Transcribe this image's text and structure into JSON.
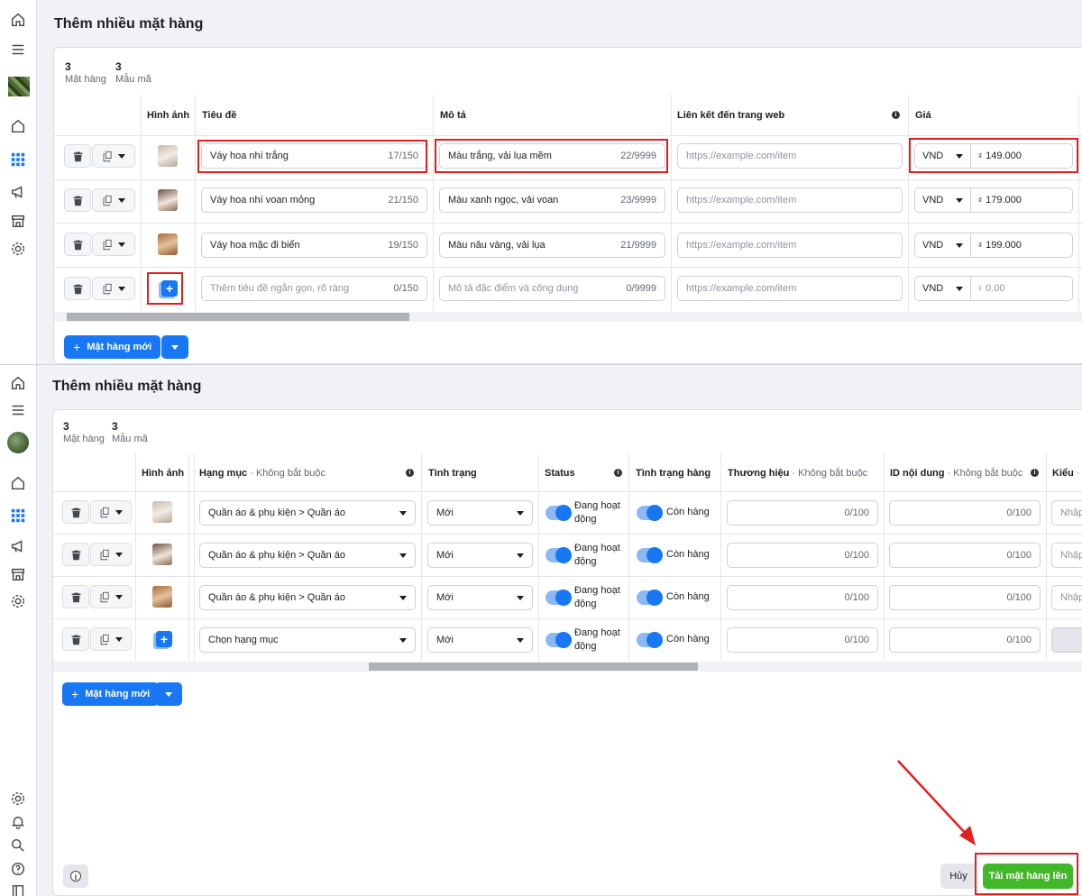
{
  "panel1": {
    "title": "Thêm nhiều mặt hàng",
    "stats": {
      "items_count": "3",
      "items_label": "Mặt hàng",
      "variants_count": "3",
      "variants_label": "Mẫu mã"
    },
    "headers": {
      "image": "Hình ảnh",
      "title": "Tiêu đề",
      "description": "Mô tả",
      "link": "Liên kết đến trang web",
      "price": "Giá"
    },
    "rows": [
      {
        "title": "Váy hoa nhí trắng",
        "title_count": "17/150",
        "desc": "Màu trắng, vải lụa mềm",
        "desc_count": "22/9999",
        "link_placeholder": "https://example.com/item",
        "currency": "VND",
        "price_symbol": "₫",
        "price": "149.000"
      },
      {
        "title": "Váy hoa nhí voan mỏng",
        "title_count": "21/150",
        "desc": "Màu xanh ngọc, vải voan",
        "desc_count": "23/9999",
        "link_placeholder": "https://example.com/item",
        "currency": "VND",
        "price_symbol": "₫",
        "price": "179.000"
      },
      {
        "title": "Váy hoa mặc đi biển",
        "title_count": "19/150",
        "desc": "Màu nâu vàng, vải lụa",
        "desc_count": "21/9999",
        "link_placeholder": "https://example.com/item",
        "currency": "VND",
        "price_symbol": "₫",
        "price": "199.000"
      },
      {
        "title": "Thêm tiêu đề ngắn gọn, rõ ràng",
        "title_count": "0/150",
        "desc": "Mô tả đặc điểm và công dụng",
        "desc_count": "0/9999",
        "link_placeholder": "https://example.com/item",
        "currency": "VND",
        "price_symbol": "₫",
        "price": "0.00"
      }
    ],
    "new_item_label": "Mặt hàng mới"
  },
  "panel2": {
    "title": "Thêm nhiều mặt hàng",
    "stats": {
      "items_count": "3",
      "items_label": "Mặt hàng",
      "variants_count": "3",
      "variants_label": "Mẫu mã"
    },
    "headers": {
      "image": "Hình ảnh",
      "category": "Hạng mục",
      "optional": " · Không bắt buộc",
      "condition": "Tình trạng",
      "status": "Status",
      "stock": "Tình trạng hàng",
      "brand": "Thương hiệu",
      "content_id": "ID nội dung",
      "style": "Kiểu",
      "style_cut": " · K"
    },
    "rows": [
      {
        "category": "Quần áo & phụ kiện > Quần áo",
        "condition": "Mới",
        "status_line1": "Đang hoạt",
        "status_line2": "động",
        "stock": "Còn hàng",
        "brand_count": "0/100",
        "id_count": "0/100",
        "style_ph": "Nhập"
      },
      {
        "category": "Quần áo & phụ kiện > Quần áo",
        "condition": "Mới",
        "status_line1": "Đang hoạt",
        "status_line2": "động",
        "stock": "Còn hàng",
        "brand_count": "0/100",
        "id_count": "0/100",
        "style_ph": "Nhập"
      },
      {
        "category": "Quần áo & phụ kiện > Quần áo",
        "condition": "Mới",
        "status_line1": "Đang hoạt",
        "status_line2": "động",
        "stock": "Còn hàng",
        "brand_count": "0/100",
        "id_count": "0/100",
        "style_ph": "Nhập"
      },
      {
        "category": "Chọn hạng mục",
        "condition": "Mới",
        "status_line1": "Đang hoạt",
        "status_line2": "động",
        "stock": "Còn hàng",
        "brand_count": "0/100",
        "id_count": "0/100",
        "style_ph": ""
      }
    ],
    "new_item_label": "Mặt hàng mới"
  },
  "footer": {
    "cancel_label": "Hủy",
    "upload_label": "Tải mặt hàng lên"
  },
  "icons": {
    "home": "home-icon",
    "menu": "menu-icon",
    "grid": "grid-icon",
    "megaphone": "megaphone-icon",
    "store": "store-icon",
    "settings": "gear-icon",
    "bell": "bell-icon",
    "search": "search-icon",
    "help": "help-icon",
    "book": "book-icon",
    "trash": "trash-icon",
    "copy": "copy-icon",
    "info": "info-icon"
  },
  "colors": {
    "accent": "#1877f2",
    "success": "#42b72a",
    "highlight": "#e41e1e"
  }
}
